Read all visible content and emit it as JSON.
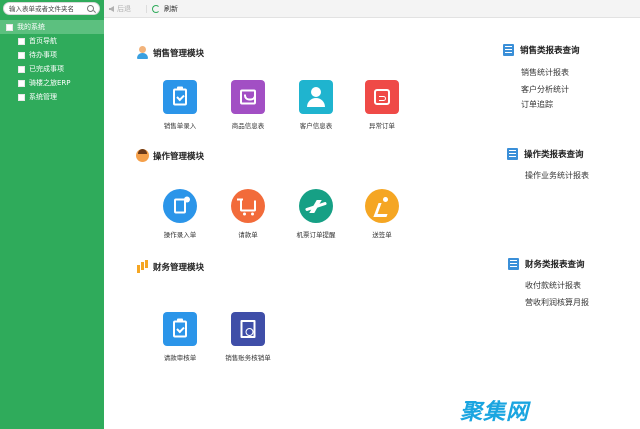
{
  "sidebar": {
    "search_placeholder": "输入表单或者文件夹名",
    "root": "我的系统",
    "items": [
      {
        "label": "首页导航"
      },
      {
        "label": "待办事项"
      },
      {
        "label": "已完成事项"
      },
      {
        "label": "骑楼之旅ERP"
      },
      {
        "label": "系统管理"
      }
    ]
  },
  "toolbar": {
    "back_label": "后退",
    "refresh_label": "刷新"
  },
  "modules": {
    "sales": {
      "title": "销售管理模块",
      "apps": [
        {
          "label": "销售单录入",
          "color": "#2b95e9"
        },
        {
          "label": "商品信息表",
          "color": "#a24fc4"
        },
        {
          "label": "客户信息表",
          "color": "#1fb4cf"
        },
        {
          "label": "异常订单",
          "color": "#ef4a47"
        }
      ]
    },
    "ops": {
      "title": "操作管理模块",
      "apps": [
        {
          "label": "操作录入单",
          "color": "#2b95e9"
        },
        {
          "label": "请款单",
          "color": "#f26b3a"
        },
        {
          "label": "机票订单提醒",
          "color": "#16a085"
        },
        {
          "label": "送签单",
          "color": "#f5a623"
        }
      ]
    },
    "finance": {
      "title": "财务管理模块",
      "apps": [
        {
          "label": "请款审核单",
          "color": "#2b95e9"
        },
        {
          "label": "销售账务核销单",
          "color": "#3f4ea8"
        }
      ]
    }
  },
  "reports": {
    "sales": {
      "title": "销售类报表查询",
      "links": [
        "销售统计报表",
        "客户分析统计",
        "订单追踪"
      ]
    },
    "ops": {
      "title": "操作类报表查询",
      "links": [
        "操作业务统计报表"
      ]
    },
    "finance": {
      "title": "财务类报表查询",
      "links": [
        "收付款统计报表",
        "营收利润核算月报"
      ]
    }
  },
  "watermark": "聚集网",
  "colors": {
    "sidebar_bg": "#2fab5b",
    "sidebar_selected": "#5cc07f",
    "report_icon": "#3a8fd8"
  }
}
